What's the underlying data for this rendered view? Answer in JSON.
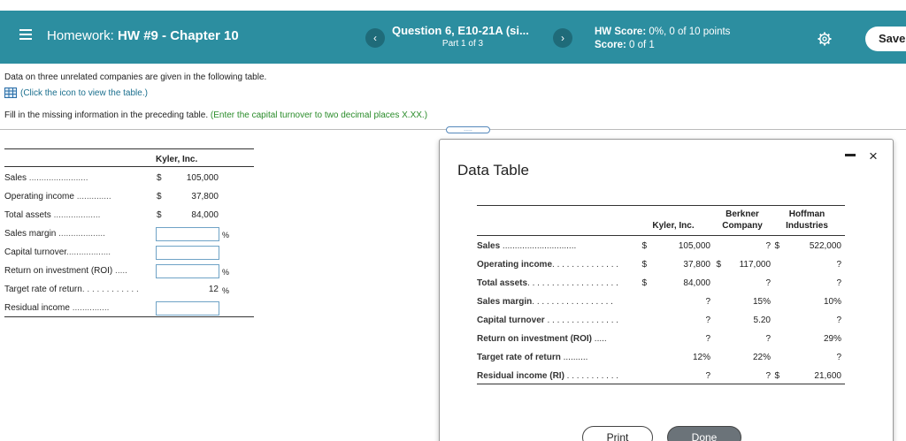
{
  "header": {
    "menu_icon": "hamburger-menu-icon",
    "hw_prefix": "Homework: ",
    "hw_name": "HW #9 - Chapter 10",
    "prev_icon": "‹",
    "next_icon": "›",
    "question_title": "Question 6, E10-21A (si...",
    "question_part": "Part 1 of 3",
    "hw_score_label": "HW Score: ",
    "hw_score_value": "0%, 0 of 10 points",
    "score_label": "Score: ",
    "score_value": "0 of 1",
    "settings_icon": "gear-icon",
    "save_label": "Save",
    "colors": {
      "bar": "#2c8ea0",
      "nav_button": "#1f6b79"
    }
  },
  "instructions": {
    "intro": "Data on three unrelated companies are given in the following table.",
    "table_link": "(Click the icon to view the table.)",
    "fill_in": "Fill in the missing information in the preceding table.",
    "fill_in_hint": "(Enter the capital turnover to two decimal places X.XX.)",
    "expander": "....."
  },
  "worksheet": {
    "company": "Kyler, Inc.",
    "rows": [
      {
        "label": "Sales",
        "dots": " ........................",
        "dollar": "$",
        "value": "105,000"
      },
      {
        "label": "Operating income",
        "dots": " ..............",
        "dollar": "$",
        "value": "37,800"
      },
      {
        "label": "Total assets",
        "dots": " ...................",
        "dollar": "$",
        "value": "84,000"
      },
      {
        "label": "Sales margin",
        "dots": " ...................",
        "unit": "%"
      },
      {
        "label": "Capital turnover",
        "dots": ".................."
      },
      {
        "label": "Return on investment (ROI)",
        "dots": " .....",
        "unit": "%"
      },
      {
        "label": "Target rate of return",
        "dots": ". . . . . . . . . . . .",
        "value": "12",
        "unit": "%"
      },
      {
        "label": "Residual income",
        "dots": " ..............."
      }
    ]
  },
  "dialog": {
    "title": "Data Table",
    "minimize_icon": "minimize-icon",
    "close_icon": "×",
    "columns": [
      "Kyler, Inc.",
      "Berkner Company",
      "Hoffman Industries"
    ],
    "col_kyler": "Kyler, Inc.",
    "col_berkner_1": "Berkner",
    "col_berkner_2": "Company",
    "col_hoffman_1": "Hoffman",
    "col_hoffman_2": "Industries",
    "rows": [
      {
        "label": "Sales",
        "dots": " ..............................",
        "d1": "$",
        "kyler": "105,000",
        "d2": "",
        "berkner": "?",
        "d3": "$",
        "hoffman": "522,000"
      },
      {
        "label": "Operating income",
        "dots": ". . . . . . . . . . . . . .",
        "d1": "$",
        "kyler": "37,800",
        "d2": "$",
        "berkner": "117,000",
        "d3": "",
        "hoffman": "?"
      },
      {
        "label": "Total assets",
        "dots": ". . . . . . . . . . . . . . . . . . .",
        "d1": "$",
        "kyler": "84,000",
        "d2": "",
        "berkner": "?",
        "d3": "",
        "hoffman": "?"
      },
      {
        "label": "Sales margin",
        "dots": ". . . . . . . . . . . . . . . . .",
        "d1": "",
        "kyler": "?",
        "d2": "",
        "berkner": "15%",
        "d3": "",
        "hoffman": "10%"
      },
      {
        "label": "Capital turnover",
        "dots": " . . . . . . . . . . . . . . .",
        "d1": "",
        "kyler": "?",
        "d2": "",
        "berkner": "5.20",
        "d3": "",
        "hoffman": "?"
      },
      {
        "label": "Return on investment (ROI)",
        "dots": " .....",
        "d1": "",
        "kyler": "?",
        "d2": "",
        "berkner": "?",
        "d3": "",
        "hoffman": "29%"
      },
      {
        "label": "Target rate of return",
        "dots": "      ..........",
        "d1": "",
        "kyler": "12%",
        "d2": "",
        "berkner": "22%",
        "d3": "",
        "hoffman": "?"
      },
      {
        "label": "Residual income (RI)",
        "dots": " . . . . . . . . . . .",
        "d1": "",
        "kyler": "?",
        "d2": "",
        "berkner": "?",
        "d3": "$",
        "hoffman": "21,600"
      }
    ],
    "print_label": "Print",
    "done_label": "Done"
  }
}
